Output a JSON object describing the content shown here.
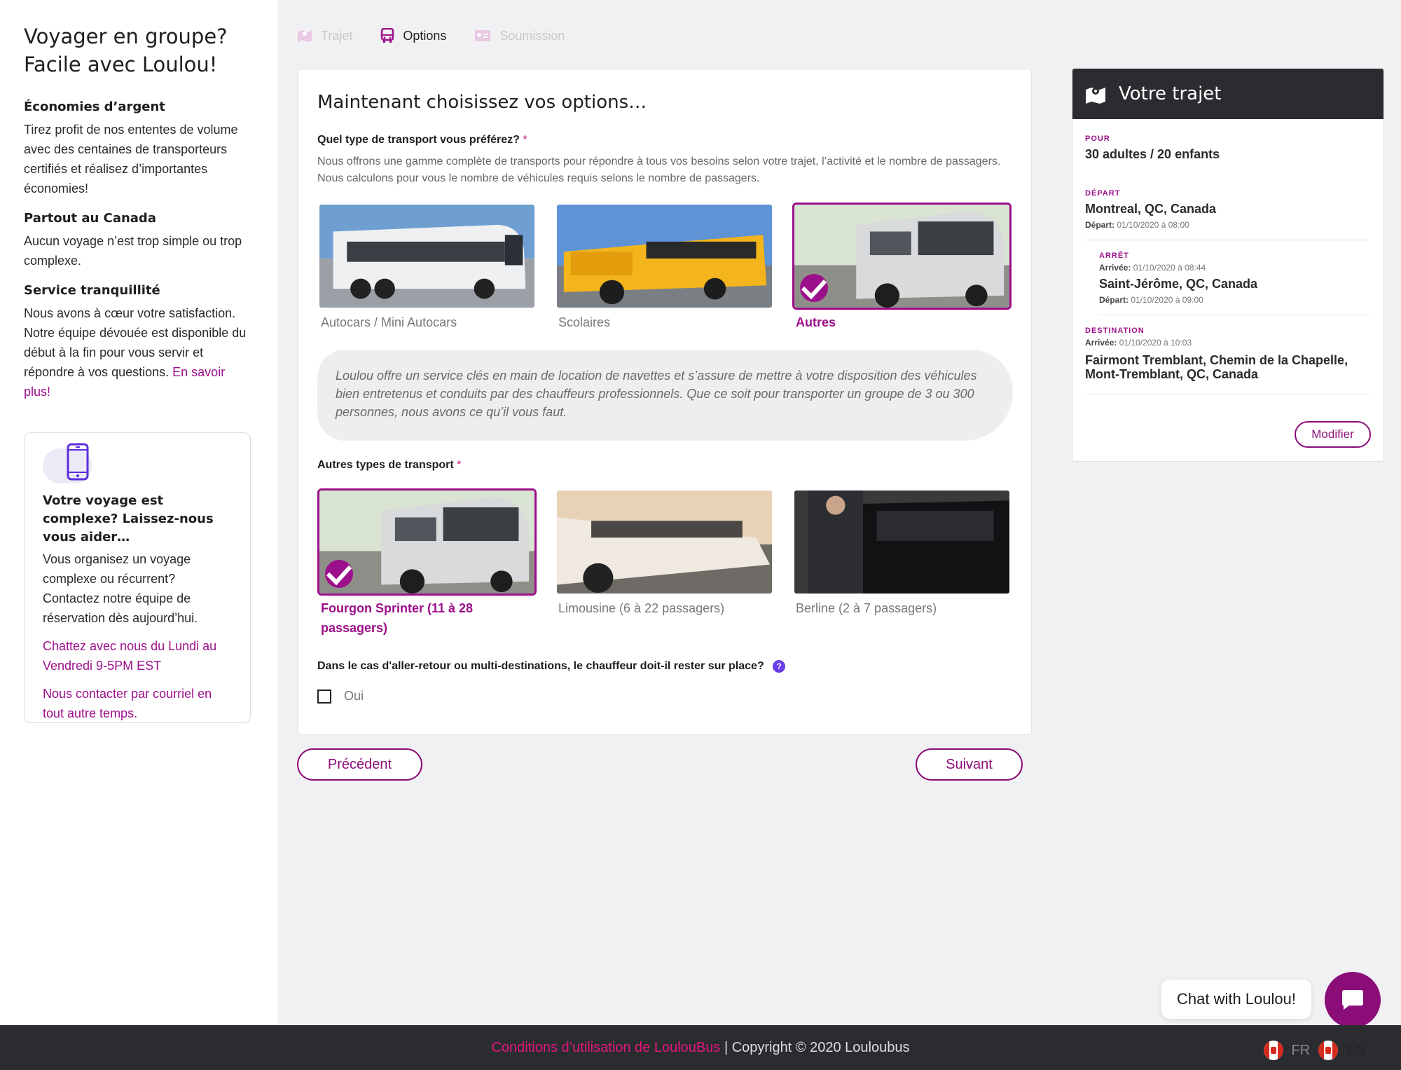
{
  "sidebar": {
    "title": "Voyager en groupe? Facile avec Loulou!",
    "sections": [
      {
        "heading": "Économies d’argent",
        "text": "Tirez profit de nos ententes de volume avec des centaines de transporteurs certifiés et réalisez d’importantes économies!"
      },
      {
        "heading": "Partout au Canada",
        "text": "Aucun voyage n’est trop simple ou trop complexe."
      },
      {
        "heading": "Service tranquillité",
        "text": "Nous avons à cœur votre satisfaction. Notre équipe dévouée est disponible du début à la fin pour vous servir et répondre à vos questions."
      }
    ],
    "learn_more": "En savoir plus!",
    "help": {
      "title": "Votre voyage est complexe? Laissez-nous vous aider…",
      "text": "Vous organisez un voyage complexe ou récurrent? Contactez notre équipe de réservation dès aujourd’hui.",
      "chat_link": "Chattez avec nous du Lundi au Vendredi 9-5PM EST",
      "email_link": "Nous contacter par courriel en tout autre temps."
    }
  },
  "steps": [
    {
      "label": "Trajet",
      "icon": "map-icon",
      "active": false
    },
    {
      "label": "Options",
      "icon": "bus-icon",
      "active": true
    },
    {
      "label": "Soumission",
      "icon": "id-card-icon",
      "active": false
    }
  ],
  "main": {
    "title": "Maintenant choisissez vos options…",
    "q1_label": "Quel type de transport vous préférez?",
    "required_mark": "*",
    "q1_desc": "Nous offrons une gamme complète de transports pour répondre à tous vos besoins selon votre trajet, l’activité et le nombre de passagers. Nous calculons pour vous le nombre de véhicules requis selons le nombre de passagers.",
    "transport_types": [
      {
        "label": "Autocars / Mini Autocars",
        "selected": false
      },
      {
        "label": "Scolaires",
        "selected": false
      },
      {
        "label": "Autres",
        "selected": true
      }
    ],
    "info": "Loulou offre un service clés en main de location de navettes et s’assure de mettre à votre disposition des véhicules bien entretenus et conduits par des chauffeurs professionnels. Que ce soit pour transporter un groupe de 3 ou 300 personnes, nous avons ce qu’il vous faut.",
    "q2_label": "Autres types de transport",
    "other_types": [
      {
        "label": "Fourgon Sprinter (11 à 28 passagers)",
        "selected": true
      },
      {
        "label": "Limousine (6 à 22 passagers)",
        "selected": false
      },
      {
        "label": "Berline (2 à 7 passagers)",
        "selected": false
      }
    ],
    "q3_label": "Dans le cas d'aller-retour ou multi-destinations, le chauffeur doit-il rester sur place?",
    "q3_help": "?",
    "q3_option": "Oui",
    "q3_checked": false
  },
  "nav": {
    "prev": "Précédent",
    "next": "Suivant"
  },
  "trip": {
    "title": "Votre trajet",
    "for_label": "POUR",
    "for_value": "30 adultes / 20 enfants",
    "departure_label": "DÉPART",
    "departure_place": "Montreal, QC, Canada",
    "departure_key": "Départ:",
    "departure_time": "01/10/2020 à 08:00",
    "stop_label": "ARRÊT",
    "stop_arrival_key": "Arrivée:",
    "stop_arrival": "01/10/2020 à 08:44",
    "stop_place": "Saint-Jérôme, QC, Canada",
    "stop_departure_key": "Départ:",
    "stop_departure": "01/10/2020 à 09:00",
    "dest_label": "DESTINATION",
    "dest_arrival_key": "Arrivée:",
    "dest_arrival": "01/10/2020 à 10:03",
    "dest_place": "Fairmont Tremblant, Chemin de la Chapelle, Mont-Tremblant, QC, Canada",
    "modify": "Modifier"
  },
  "chat": {
    "label": "Chat with Loulou!"
  },
  "footer": {
    "terms": "Conditions d’utilisation de LoulouBus",
    "copyright": "| Copyright © 2020 Louloubus",
    "lang_fr": "FR",
    "lang_en": "EN"
  },
  "colors": {
    "accent": "#9c0f8a",
    "dark_header": "#2c2c30",
    "footer": "#2a2c30",
    "help_icon": "#6a3de8"
  }
}
